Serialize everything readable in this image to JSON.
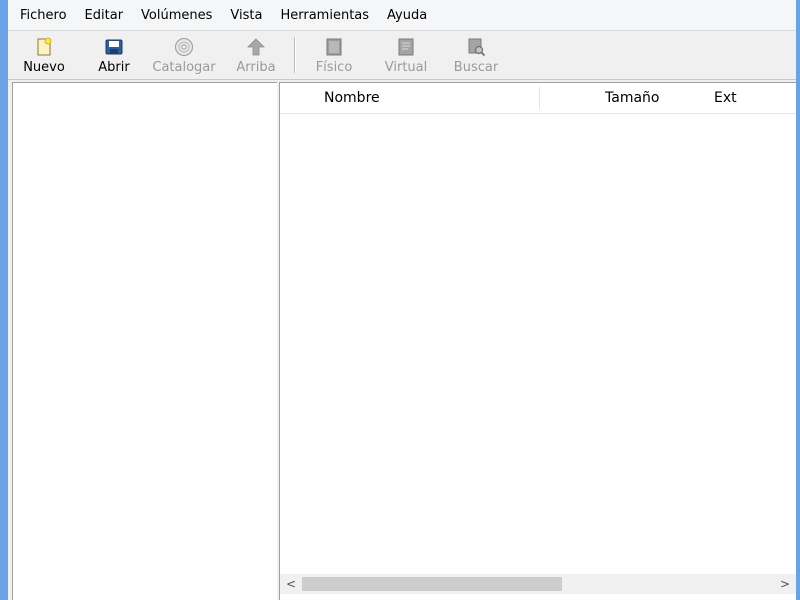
{
  "menu": [
    "Fichero",
    "Editar",
    "Volúmenes",
    "Vista",
    "Herramientas",
    "Ayuda"
  ],
  "toolbar": {
    "nuevo": {
      "label": "Nuevo",
      "icon": "new-file-icon",
      "enabled": true
    },
    "abrir": {
      "label": "Abrir",
      "icon": "open-disk-icon",
      "enabled": true
    },
    "catalogar": {
      "label": "Catalogar",
      "icon": "disc-icon",
      "enabled": false
    },
    "arriba": {
      "label": "Arriba",
      "icon": "up-arrow-icon",
      "enabled": false
    },
    "fisico": {
      "label": "Físico",
      "icon": "physical-view-icon",
      "enabled": false
    },
    "virtual": {
      "label": "Virtual",
      "icon": "virtual-view-icon",
      "enabled": false
    },
    "buscar": {
      "label": "Buscar",
      "icon": "search-icon",
      "enabled": false
    }
  },
  "file_list": {
    "columns": [
      "Nombre",
      "Tamaño",
      "Ext"
    ],
    "rows": []
  },
  "scrollbar": {
    "left_arrow": "<",
    "right_arrow": ">"
  },
  "colors": {
    "desktop": "#6aa2e6",
    "chrome": "#f0f0f0",
    "disabled_text": "#9a9a9a"
  }
}
